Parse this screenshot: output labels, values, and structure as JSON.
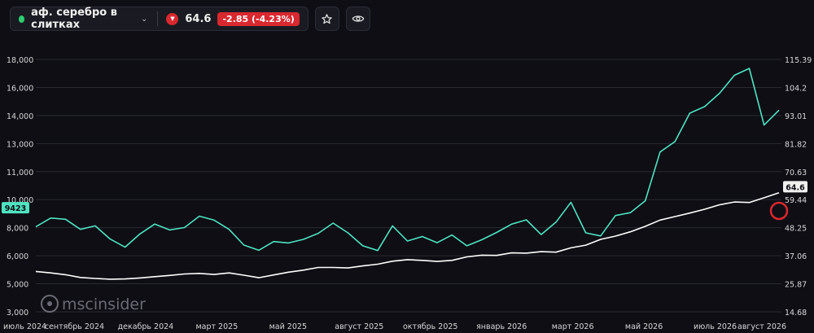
{
  "toolbar": {
    "asset_name": "аф. серебро в слитках",
    "price": "64.6",
    "change": "-2.85 (-4.23%)"
  },
  "watermark": "mscinsider",
  "colors": {
    "background": "#0e0e14",
    "series_teal": "#4fe3c1",
    "series_white": "#ffffff",
    "negative": "#d9282f",
    "live_dot": "#2ecc71",
    "grid": "#2a2b33"
  },
  "chart_data": {
    "type": "line",
    "x_labels": [
      "июль 2024",
      "сентябрь 2024",
      "декабрь 2024",
      "март 2025",
      "май 2025",
      "август 2025",
      "октябрь 2025",
      "январь 2026",
      "март 2026",
      "май 2026",
      "июль 2026",
      "август 2026"
    ],
    "y_left_ticks": [
      "18,000",
      "16,000",
      "14,000",
      "13,000",
      "11,000",
      "10,000",
      "8,000",
      "6,000",
      "5,000",
      "3,000"
    ],
    "y_right_ticks": [
      "115.39",
      "104.2",
      "93.01",
      "81.82",
      "70.63",
      "59.44",
      "48.25",
      "37.06",
      "25.87",
      "14.68"
    ],
    "y_left_range": [
      3000,
      18000
    ],
    "y_right_range": [
      14.68,
      115.39
    ],
    "left_badge": "9423",
    "right_badge": "64.6",
    "grid": true,
    "series": [
      {
        "axis": "left",
        "color": "#4fe3c1",
        "x": [
          0,
          2,
          4,
          6,
          8,
          10,
          12,
          14,
          16,
          18,
          20,
          22,
          24,
          26,
          28,
          30,
          32,
          34,
          36,
          38,
          40,
          42,
          44,
          46,
          48,
          50,
          52,
          54,
          56,
          58,
          60,
          62,
          64,
          66,
          68,
          70,
          72,
          74,
          76,
          78,
          80,
          82,
          84,
          86,
          88,
          90,
          92,
          94,
          96,
          98,
          100
        ],
        "values": [
          8060,
          8690,
          8600,
          7880,
          8130,
          7190,
          6610,
          7550,
          8260,
          7840,
          8010,
          8820,
          8540,
          7880,
          6760,
          6390,
          7010,
          6910,
          7170,
          7600,
          8330,
          7630,
          6710,
          6370,
          8130,
          7050,
          7370,
          6930,
          7480,
          6710,
          7140,
          7660,
          8250,
          8560,
          7510,
          8400,
          9810,
          7630,
          7410,
          8870,
          9070,
          9920,
          12400,
          13070,
          14170,
          14640,
          15590,
          16870,
          17360,
          13660,
          14380
        ]
      },
      {
        "axis": "right",
        "color": "#ffffff",
        "x": [
          0,
          2,
          4,
          6,
          8,
          10,
          12,
          14,
          16,
          18,
          20,
          22,
          24,
          26,
          28,
          30,
          32,
          34,
          36,
          38,
          40,
          42,
          44,
          46,
          48,
          50,
          52,
          54,
          56,
          58,
          60,
          62,
          64,
          66,
          68,
          70,
          72,
          74,
          76,
          78,
          80,
          82,
          84,
          86,
          88,
          90,
          92,
          94,
          96,
          98,
          100
        ],
        "values": [
          30.8,
          30.2,
          29.5,
          28.4,
          28.0,
          27.7,
          27.8,
          28.2,
          28.7,
          29.2,
          29.8,
          30.0,
          29.6,
          30.2,
          29.3,
          28.3,
          29.4,
          30.5,
          31.3,
          32.4,
          32.4,
          32.2,
          33.0,
          33.7,
          34.9,
          35.5,
          35.2,
          34.8,
          35.2,
          36.6,
          37.3,
          37.2,
          38.2,
          38.1,
          38.7,
          38.5,
          40.2,
          41.3,
          43.6,
          44.9,
          46.6,
          48.8,
          51.3,
          52.7,
          54.1,
          55.6,
          57.4,
          58.5,
          58.3,
          60.2,
          62.2
        ]
      }
    ]
  }
}
